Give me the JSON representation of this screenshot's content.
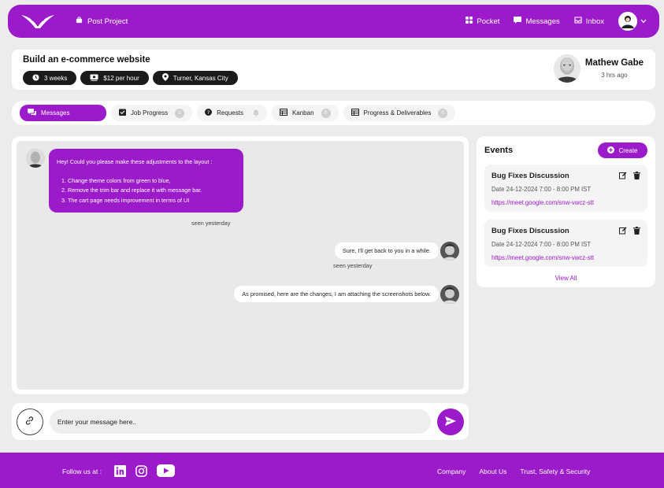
{
  "navbar": {
    "post_project": "Post Project",
    "pocket": "Pocket",
    "messages": "Messages",
    "inbox": "Inbox"
  },
  "project": {
    "title": "Build an e-commerce website",
    "duration": "3 weeks",
    "rate": "$12 per hour",
    "location": "Turner, Kansas City"
  },
  "profile": {
    "name": "Mathew Gabe",
    "last_seen": "3 hrs ago"
  },
  "tabs": [
    {
      "label": "Messages"
    },
    {
      "label": "Job Progress",
      "count": "0"
    },
    {
      "label": "Requests"
    },
    {
      "label": "Kanban",
      "count": "0"
    },
    {
      "label": "Progress & Deliverables",
      "count": "0"
    }
  ],
  "chat": {
    "msg1_intro": "Hey! Could you please make these adjustments to the layout :",
    "msg1_items": [
      "Change theme colors from green to blue,",
      "Remove the trim bar and replace it with message bar.",
      "The cart page needs improvement in terms of UI"
    ],
    "msg1_seen": "seen yesterday",
    "msg2": "Sure, I'll get back to you in a while.",
    "msg2_seen": "seen yesterday",
    "msg3": "As promised, here are the changes, I am attaching the screenshots below."
  },
  "composer": {
    "placeholder": "Enter your message here.."
  },
  "events": {
    "title": "Events",
    "create_label": "Create",
    "view_all": "View All",
    "items": [
      {
        "name": "Bug Fixes Discussion",
        "date": "Date 24-12-2024   7:00 - 8:00 PM IST",
        "link": "https://meet.google.com/snw-vwcz-stt"
      },
      {
        "name": "Bug Fixes Discussion",
        "date": "Date 24-12-2024   7:00 - 8:00 PM IST",
        "link": "https://meet.google.com/snw-vwcz-stt"
      }
    ]
  },
  "footer": {
    "follow": "Follow us at :",
    "links": [
      "Company",
      "About Us",
      "Trust, Safety & Security"
    ]
  },
  "colors": {
    "brand": "#9b1ac9",
    "chip_bg": "#1b1b1b"
  }
}
